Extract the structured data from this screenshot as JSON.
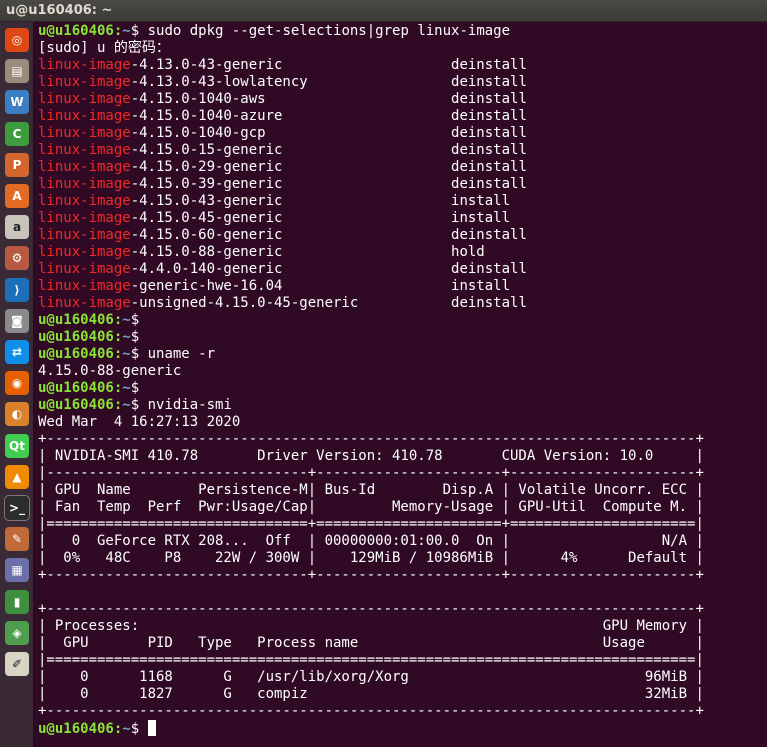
{
  "window": {
    "title": "u@u160406: ~"
  },
  "launcher": {
    "items": [
      {
        "name": "dash-home-icon",
        "color": "#dd4814",
        "glyph": "◎"
      },
      {
        "name": "files-icon",
        "color": "#9a8c7c",
        "glyph": "▤"
      },
      {
        "name": "writer-icon",
        "color": "#3b7ec4",
        "glyph": "W"
      },
      {
        "name": "calc-icon",
        "color": "#3e9b3e",
        "glyph": "C"
      },
      {
        "name": "impress-icon",
        "color": "#d2662d",
        "glyph": "P"
      },
      {
        "name": "software-center-icon",
        "color": "#e36b23",
        "glyph": "A"
      },
      {
        "name": "amazon-icon",
        "color": "#c8c4bc",
        "glyph": "a"
      },
      {
        "name": "settings-icon",
        "color": "#b85a42",
        "glyph": "⚙"
      },
      {
        "name": "vscode-icon",
        "color": "#1d6fb8",
        "glyph": "⟩"
      },
      {
        "name": "screenshot-icon",
        "color": "#8a8a8a",
        "glyph": "◙"
      },
      {
        "name": "teamviewer-icon",
        "color": "#0e8ee9",
        "glyph": "⇄"
      },
      {
        "name": "firefox-icon",
        "color": "#e66000",
        "glyph": "◉"
      },
      {
        "name": "image-viewer-icon",
        "color": "#d9822b",
        "glyph": "◐"
      },
      {
        "name": "qt-icon",
        "color": "#41cd52",
        "glyph": "Qt"
      },
      {
        "name": "vlc-icon",
        "color": "#f08a00",
        "glyph": "▲"
      },
      {
        "name": "terminal-icon",
        "color": "#2c2c2c",
        "glyph": ">_"
      },
      {
        "name": "text-tool-icon",
        "color": "#c06a3a",
        "glyph": "✎"
      },
      {
        "name": "monitor-icon",
        "color": "#6d6fa8",
        "glyph": "▦"
      },
      {
        "name": "sd-card-icon",
        "color": "#3e8f3e",
        "glyph": "▮"
      },
      {
        "name": "downloader-icon",
        "color": "#4f9e4f",
        "glyph": "◈"
      },
      {
        "name": "text-editor-icon",
        "color": "#d8d4c6",
        "glyph": "✐"
      }
    ]
  },
  "terminal": {
    "lines": [
      {
        "type": "prompt",
        "user": "u@u160406",
        "path": "~",
        "command": "sudo dpkg --get-selections|grep linux-image"
      },
      {
        "type": "text",
        "text": "[sudo] u 的密码："
      },
      {
        "type": "grep",
        "highlight": "linux-image",
        "rest": "-4.13.0-43-generic                    deinstall"
      },
      {
        "type": "grep",
        "highlight": "linux-image",
        "rest": "-4.13.0-43-lowlatency                 deinstall"
      },
      {
        "type": "grep",
        "highlight": "linux-image",
        "rest": "-4.15.0-1040-aws                      deinstall"
      },
      {
        "type": "grep",
        "highlight": "linux-image",
        "rest": "-4.15.0-1040-azure                    deinstall"
      },
      {
        "type": "grep",
        "highlight": "linux-image",
        "rest": "-4.15.0-1040-gcp                      deinstall"
      },
      {
        "type": "grep",
        "highlight": "linux-image",
        "rest": "-4.15.0-15-generic                    deinstall"
      },
      {
        "type": "grep",
        "highlight": "linux-image",
        "rest": "-4.15.0-29-generic                    deinstall"
      },
      {
        "type": "grep",
        "highlight": "linux-image",
        "rest": "-4.15.0-39-generic                    deinstall"
      },
      {
        "type": "grep",
        "highlight": "linux-image",
        "rest": "-4.15.0-43-generic                    install"
      },
      {
        "type": "grep",
        "highlight": "linux-image",
        "rest": "-4.15.0-45-generic                    install"
      },
      {
        "type": "grep",
        "highlight": "linux-image",
        "rest": "-4.15.0-60-generic                    deinstall"
      },
      {
        "type": "grep",
        "highlight": "linux-image",
        "rest": "-4.15.0-88-generic                    hold"
      },
      {
        "type": "grep",
        "highlight": "linux-image",
        "rest": "-4.4.0-140-generic                    deinstall"
      },
      {
        "type": "grep",
        "highlight": "linux-image",
        "rest": "-generic-hwe-16.04                    install"
      },
      {
        "type": "grep",
        "highlight": "linux-image",
        "rest": "-unsigned-4.15.0-45-generic           deinstall"
      },
      {
        "type": "prompt",
        "user": "u@u160406",
        "path": "~",
        "command": ""
      },
      {
        "type": "prompt",
        "user": "u@u160406",
        "path": "~",
        "command": ""
      },
      {
        "type": "prompt",
        "user": "u@u160406",
        "path": "~",
        "command": "uname -r"
      },
      {
        "type": "text",
        "text": "4.15.0-88-generic"
      },
      {
        "type": "prompt",
        "user": "u@u160406",
        "path": "~",
        "command": ""
      },
      {
        "type": "prompt",
        "user": "u@u160406",
        "path": "~",
        "command": "nvidia-smi"
      },
      {
        "type": "text",
        "text": "Wed Mar  4 16:27:13 2020"
      },
      {
        "type": "text",
        "text": "+-----------------------------------------------------------------------------+"
      },
      {
        "type": "text",
        "text": "| NVIDIA-SMI 410.78       Driver Version: 410.78       CUDA Version: 10.0     |"
      },
      {
        "type": "text",
        "text": "|-------------------------------+----------------------+----------------------+"
      },
      {
        "type": "text",
        "text": "| GPU  Name        Persistence-M| Bus-Id        Disp.A | Volatile Uncorr. ECC |"
      },
      {
        "type": "text",
        "text": "| Fan  Temp  Perf  Pwr:Usage/Cap|         Memory-Usage | GPU-Util  Compute M. |"
      },
      {
        "type": "text",
        "text": "|===============================+======================+======================|"
      },
      {
        "type": "text",
        "text": "|   0  GeForce RTX 208...  Off  | 00000000:01:00.0  On |                  N/A |"
      },
      {
        "type": "text",
        "text": "|  0%   48C    P8    22W / 300W |    129MiB / 10986MiB |      4%      Default |"
      },
      {
        "type": "text",
        "text": "+-------------------------------+----------------------+----------------------+"
      },
      {
        "type": "text",
        "text": ""
      },
      {
        "type": "text",
        "text": "+-----------------------------------------------------------------------------+"
      },
      {
        "type": "text",
        "text": "| Processes:                                                       GPU Memory |"
      },
      {
        "type": "text",
        "text": "|  GPU       PID   Type   Process name                             Usage      |"
      },
      {
        "type": "text",
        "text": "|=============================================================================|"
      },
      {
        "type": "text",
        "text": "|    0      1168      G   /usr/lib/xorg/Xorg                            96MiB |"
      },
      {
        "type": "text",
        "text": "|    0      1827      G   compiz                                        32MiB |"
      },
      {
        "type": "text",
        "text": "+-----------------------------------------------------------------------------+"
      },
      {
        "type": "prompt",
        "user": "u@u160406",
        "path": "~",
        "command": "",
        "cursor": true
      }
    ]
  }
}
